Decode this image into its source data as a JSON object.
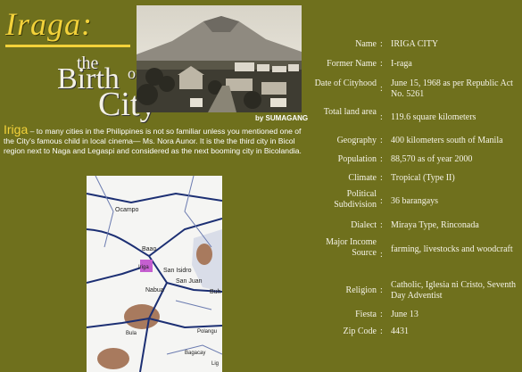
{
  "header": {
    "title_main": "Iraga:",
    "title_the": "the",
    "title_birth": "Birth",
    "title_of": "of a",
    "title_city": "City",
    "byline": "by SUMAGANG"
  },
  "intro": {
    "lead": "Iriga",
    "text": "– to many cities in the Philippines is not so familiar unless you mentioned one of the City's famous child in local cinema— Ms. Nora Aunor. It is the the third city in Bicol region next to Naga and Legaspi and considered as the next booming city in Bicolandia."
  },
  "map": {
    "labels": [
      "Ocampo",
      "Baao",
      "Iriga",
      "San Isidro",
      "San Juan",
      "Nabua",
      "Bula",
      "Buh",
      "Polangu",
      "Bagacay",
      "Lig"
    ]
  },
  "info": [
    {
      "label": "Name",
      "value": "IRIGA CITY"
    },
    {
      "label": "Former Name",
      "value": "I-raga"
    },
    {
      "label": "Date of Cityhood",
      "value": "June 15, 1968 as per Republic Act No. 5261"
    },
    {
      "label": "Total land area",
      "value": "119.6 square kilometers"
    },
    {
      "label": "Geography",
      "value": "400 kilometers south of Manila"
    },
    {
      "label": "Population",
      "value": "88,570 as of year 2000"
    },
    {
      "label": "Climate",
      "value": "Tropical (Type II)"
    },
    {
      "label": "Political Subdivision",
      "value": "36 barangays"
    },
    {
      "label": "Dialect",
      "value": "Miraya Type, Rinconada"
    },
    {
      "label": "Major Income Source",
      "value": "farming, livestocks and woodcraft"
    },
    {
      "label": "Religion",
      "value": "Catholic, Iglesia ni Cristo, Seventh Day Adventist"
    },
    {
      "label": "Fiesta",
      "value": "June 13"
    },
    {
      "label": "Zip Code",
      "value": "4431"
    }
  ],
  "colors": {
    "background": "#6f701d",
    "accent": "#f3d23a",
    "text": "#f5f3e8"
  }
}
